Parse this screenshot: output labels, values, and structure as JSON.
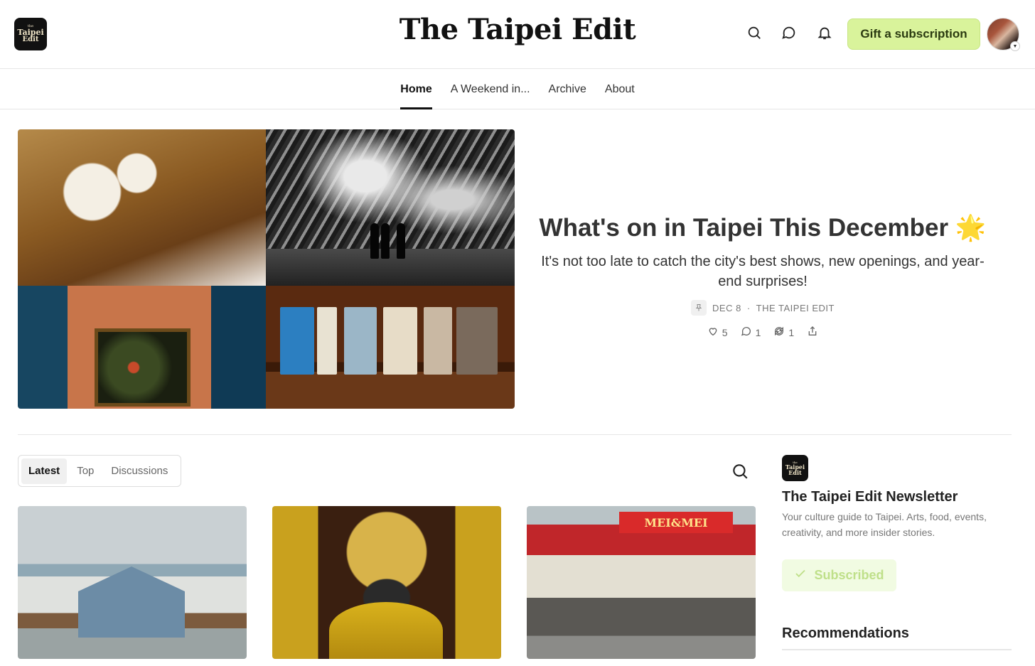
{
  "header": {
    "logo_lines": [
      "the",
      "Taipei",
      "Edit"
    ],
    "site_title": "The Taipei Edit",
    "gift_label": "Gift a subscription",
    "icons": [
      "search-icon",
      "chat-icon",
      "bell-icon"
    ]
  },
  "nav": {
    "items": [
      {
        "label": "Home",
        "active": true
      },
      {
        "label": "A Weekend in...",
        "active": false
      },
      {
        "label": "Archive",
        "active": false
      },
      {
        "label": "About",
        "active": false
      }
    ]
  },
  "hero": {
    "title": "What's on in Taipei This December",
    "emoji": "🌟",
    "subtitle": "It's not too late to catch the city's best shows, new openings, and year-end surprises!",
    "date": "DEC 8",
    "separator": "·",
    "author": "THE TAIPEI EDIT",
    "likes": "5",
    "comments": "1",
    "restacks": "1"
  },
  "feed": {
    "tabs": [
      {
        "label": "Latest",
        "active": true
      },
      {
        "label": "Top",
        "active": false
      },
      {
        "label": "Discussions",
        "active": false
      }
    ],
    "card3_sign": "MEI&MEI"
  },
  "sidebar": {
    "logo_lines": [
      "the",
      "Taipei",
      "Edit"
    ],
    "title": "The Taipei Edit Newsletter",
    "description": "Your culture guide to Taipei. Arts, food, events, creativity, and more insider stories.",
    "subscribed_label": "Subscribed",
    "recommendations_title": "Recommendations"
  },
  "colors": {
    "accent": "#d9f39b",
    "subscribed_bg": "#f1fbe2"
  }
}
